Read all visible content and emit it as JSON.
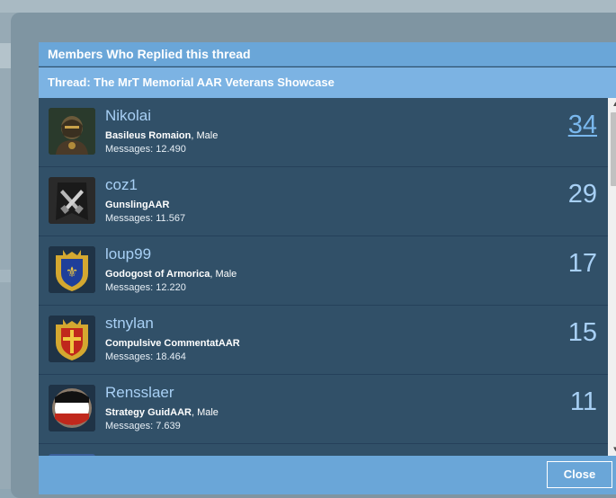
{
  "dialog": {
    "title": "Members Who Replied this thread",
    "thread_label": "Thread: The MrT Memorial AAR Veterans Showcase",
    "close_label": "Close"
  },
  "members": [
    {
      "name": "Nikolai",
      "title": "Basileus Romaion",
      "gender": ", Male",
      "messages": "Messages: 12.490",
      "count": "34",
      "avatar": "knight-portrait-avatar"
    },
    {
      "name": "coz1",
      "title": "GunslingAAR",
      "gender": "",
      "messages": "Messages: 11.567",
      "count": "29",
      "avatar": "crossed-pistols-avatar"
    },
    {
      "name": "loup99",
      "title": "Godogost of Armorica",
      "gender": ", Male",
      "messages": "Messages: 12.220",
      "count": "17",
      "avatar": "fleur-de-lis-coat-of-arms-avatar"
    },
    {
      "name": "stnylan",
      "title": "Compulsive CommentatAAR",
      "gender": "",
      "messages": "Messages: 18.464",
      "count": "15",
      "avatar": "red-cross-coat-of-arms-avatar"
    },
    {
      "name": "Rensslaer",
      "title": "Strategy GuidAAR",
      "gender": ", Male",
      "messages": "Messages: 7.639",
      "count": "11",
      "avatar": "black-white-red-shield-avatar"
    }
  ],
  "colors": {
    "header_bg": "#6aa6d8",
    "list_bg": "#315068",
    "name_link": "#a8d0f5"
  }
}
